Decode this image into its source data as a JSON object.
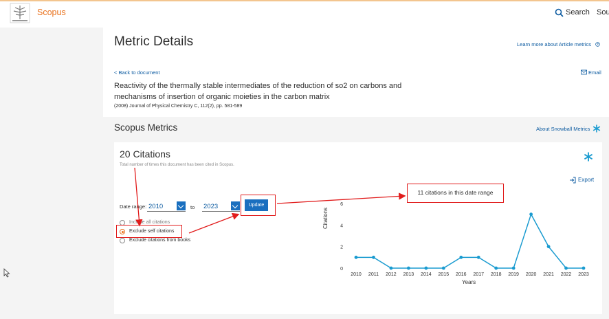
{
  "header": {
    "brand": "Scopus",
    "search_label": "Search",
    "sources_label": "Sour"
  },
  "page": {
    "title": "Metric Details",
    "learn_more": "Learn more about Article metrics",
    "back_link": "< Back to document",
    "email_link": "Email",
    "document_title": "Reactivity of the thermally stable intermediates of the reduction of so2 on carbons and mechanisms of insertion of organic moieties in the carbon matrix",
    "document_source": "(2008) Journal of Physical Chemistry C, 112(2), pp. 581-589"
  },
  "metrics": {
    "section_title": "Scopus Metrics",
    "about_snowball": "About Snowball Metrics",
    "citations_count": "20 Citations",
    "citations_sub": "Total number of times this document has been cited in Scopus.",
    "export_label": "Export",
    "date_range_label": "Date range:",
    "from_year": "2010",
    "to_label": "to",
    "to_year": "2023",
    "update_label": "Update",
    "radio_options": [
      {
        "label": "Include all citations",
        "selected": false
      },
      {
        "label": "Exclude self citations",
        "selected": true
      },
      {
        "label": "Exclude citations from books",
        "selected": false
      }
    ],
    "callout": "11 citations in this date range"
  },
  "colors": {
    "brand_orange": "#e9711c",
    "link_blue": "#0b5aa0",
    "button_blue": "#1a6fbf",
    "line_teal": "#1a9bd0",
    "annotation_red": "#e11b1b"
  },
  "chart_data": {
    "type": "line",
    "x": [
      2010,
      2011,
      2012,
      2013,
      2014,
      2015,
      2016,
      2017,
      2018,
      2019,
      2020,
      2021,
      2022,
      2023
    ],
    "series": [
      {
        "values": [
          1,
          1,
          0,
          0,
          0,
          0,
          1,
          1,
          0,
          0,
          5,
          2,
          0,
          0
        ]
      }
    ],
    "xlabel": "Years",
    "ylabel": "Citations",
    "ylim": [
      0,
      6
    ],
    "yticks": [
      0,
      2,
      4,
      6
    ],
    "grid": false
  }
}
